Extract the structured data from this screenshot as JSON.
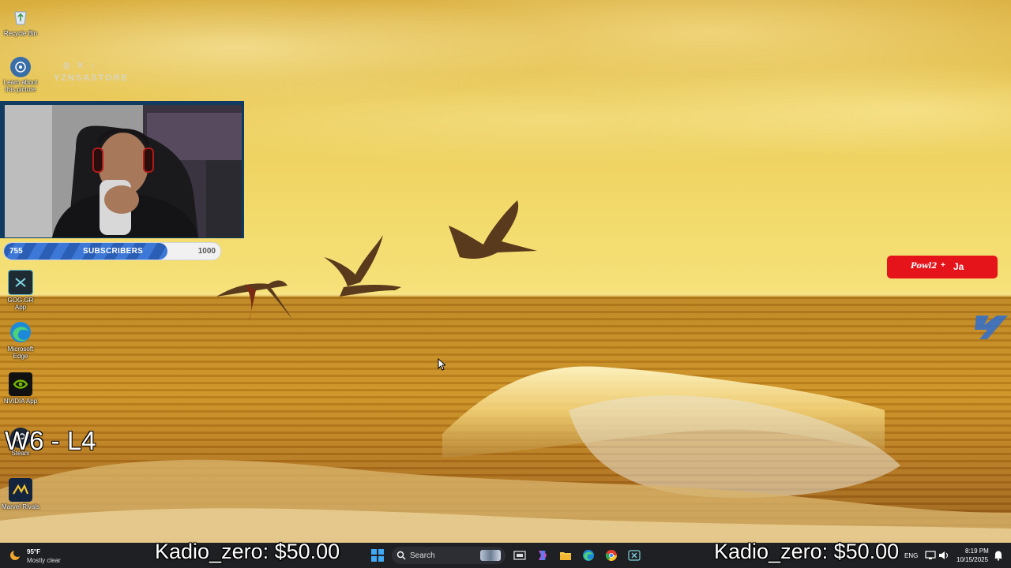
{
  "desktop": {
    "icons": [
      {
        "label": "Recycle Bin",
        "icon": "recycle-bin-icon"
      },
      {
        "label": "Learn about this picture",
        "icon": "camera-info-icon"
      },
      {
        "label": "GOG.GR App",
        "icon": "xbox-app-icon"
      },
      {
        "label": "Microsoft Edge",
        "icon": "edge-icon"
      },
      {
        "label": "NVIDIA App",
        "icon": "nvidia-icon"
      },
      {
        "label": "Steam",
        "icon": "steam-icon"
      },
      {
        "label": "Marvel Rivals",
        "icon": "marvel-rivals-icon"
      }
    ]
  },
  "overlay": {
    "social_name": "YZNSASTORE",
    "social_handles": "◎ ✕ ♪",
    "subscribers": {
      "label": "SUBSCRIBERS",
      "current": "755",
      "goal": "1000",
      "progress": 0.755
    },
    "score": "W6 - L4",
    "badge": {
      "signature": "Powl2",
      "symbol": "+",
      "text": "Ja"
    },
    "accent": "#e4141a"
  },
  "taskbar": {
    "weather": {
      "temp": "95°F",
      "condition": "Mostly clear"
    },
    "donation_left": "Kadio_zero: $50.00",
    "donation_right": "Kadio_zero: $50.00",
    "search_label": "Search",
    "language": "ENG",
    "time": "8:19 PM",
    "date": "10/15/2025"
  }
}
